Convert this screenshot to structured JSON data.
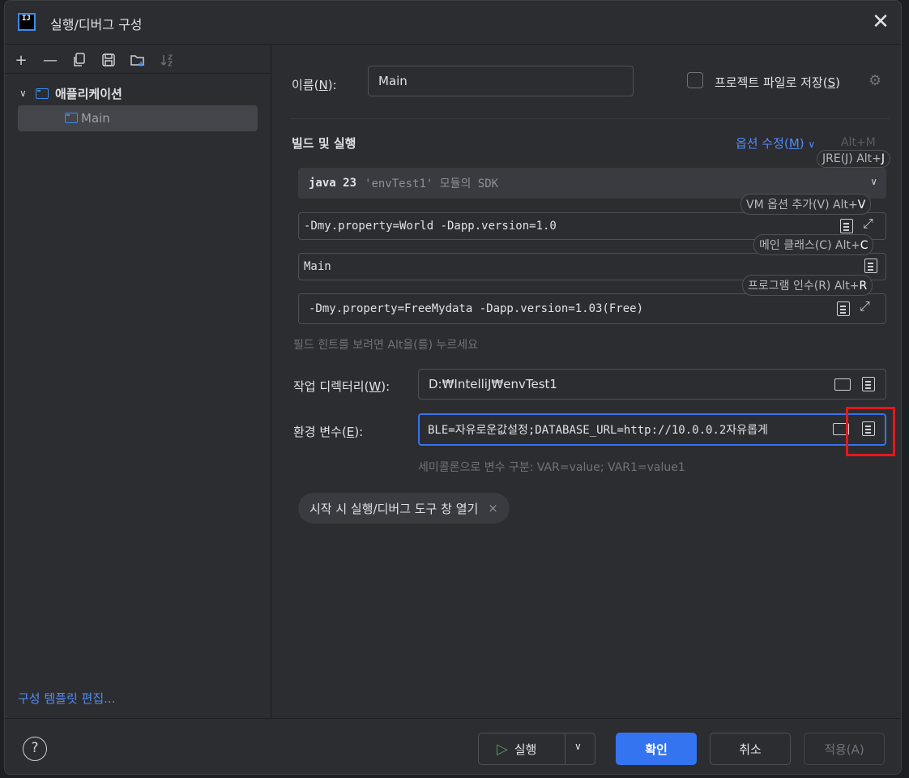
{
  "window": {
    "title": "실행/디버그 구성",
    "logo_text": "IJ"
  },
  "toolbar": {
    "add": "+",
    "remove": "—"
  },
  "tree": {
    "parent_label": "애플리케이션",
    "child_label": "Main"
  },
  "left_footer": {
    "edit_templates": "구성 템플릿 편집..."
  },
  "form": {
    "name_label_pre": "이름(",
    "name_label_key": "N",
    "name_label_post": "):",
    "name_value": "Main",
    "save_label_pre": "프로젝트 파일로 저장(",
    "save_label_key": "S",
    "save_label_post": ")",
    "section_title": "빌드 및 실행",
    "modify_options_pre": "옵션 수정(",
    "modify_options_key": "M",
    "modify_options_post": ")",
    "modify_shortcut": "Alt+M",
    "sdk_main": "java 23",
    "sdk_sub": "'envTest1' 모듈의 SDK",
    "vm_options": "-Dmy.property=World -Dapp.version=1.0",
    "main_class": "Main",
    "program_args": "-Dmy.property=FreeMydata -Dapp.version=1.03(Free)",
    "field_hint": "필드 힌트를 보려면 Alt을(를) 누르세요",
    "workdir_label_pre": "작업 디렉터리(",
    "workdir_label_key": "W",
    "workdir_label_post": "):",
    "workdir_value": "D:₩IntelliJ₩envTest1",
    "env_label_pre": "환경 변수(",
    "env_label_key": "E",
    "env_label_post": "):",
    "env_value": "BLE=자유로운값설정;DATABASE_URL=http://10.0.0.2자유롭게",
    "env_hint": "세미콜론으로 변수 구분: VAR=value; VAR1=value1",
    "chip_label": "시작 시 실행/디버그 도구 창 열기",
    "chip_close": "×"
  },
  "hints": {
    "jre": {
      "text": "JRE(J) Alt+",
      "key": "J"
    },
    "vm": {
      "text": "VM 옵션 추가(V) Alt+",
      "key": "V"
    },
    "main": {
      "text": "메인 클래스(C) Alt+",
      "key": "C"
    },
    "args": {
      "text": "프로그램 인수(R) Alt+",
      "key": "R"
    }
  },
  "buttons": {
    "help": "?",
    "run": "실행",
    "ok": "확인",
    "cancel": "취소",
    "apply": "적용(A)"
  },
  "colors": {
    "accent": "#3574f0",
    "highlight_box": "#e8161b",
    "link": "#548af7"
  }
}
